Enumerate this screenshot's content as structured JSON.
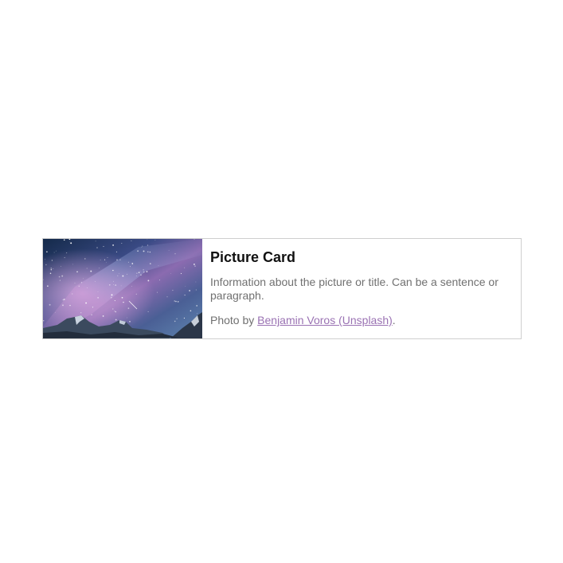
{
  "card": {
    "title": "Picture Card",
    "description": "Information about the picture or title. Can be a sentence or paragraph.",
    "credit_prefix": "Photo by ",
    "credit_link_text": "Benjamin Voros (Unsplash)",
    "credit_suffix": ".",
    "image_name": "night-sky-mountains-image",
    "link_color": "#9a72b3",
    "text_color": "#707070",
    "title_color": "#111111",
    "border_color": "#cfcfcf"
  }
}
